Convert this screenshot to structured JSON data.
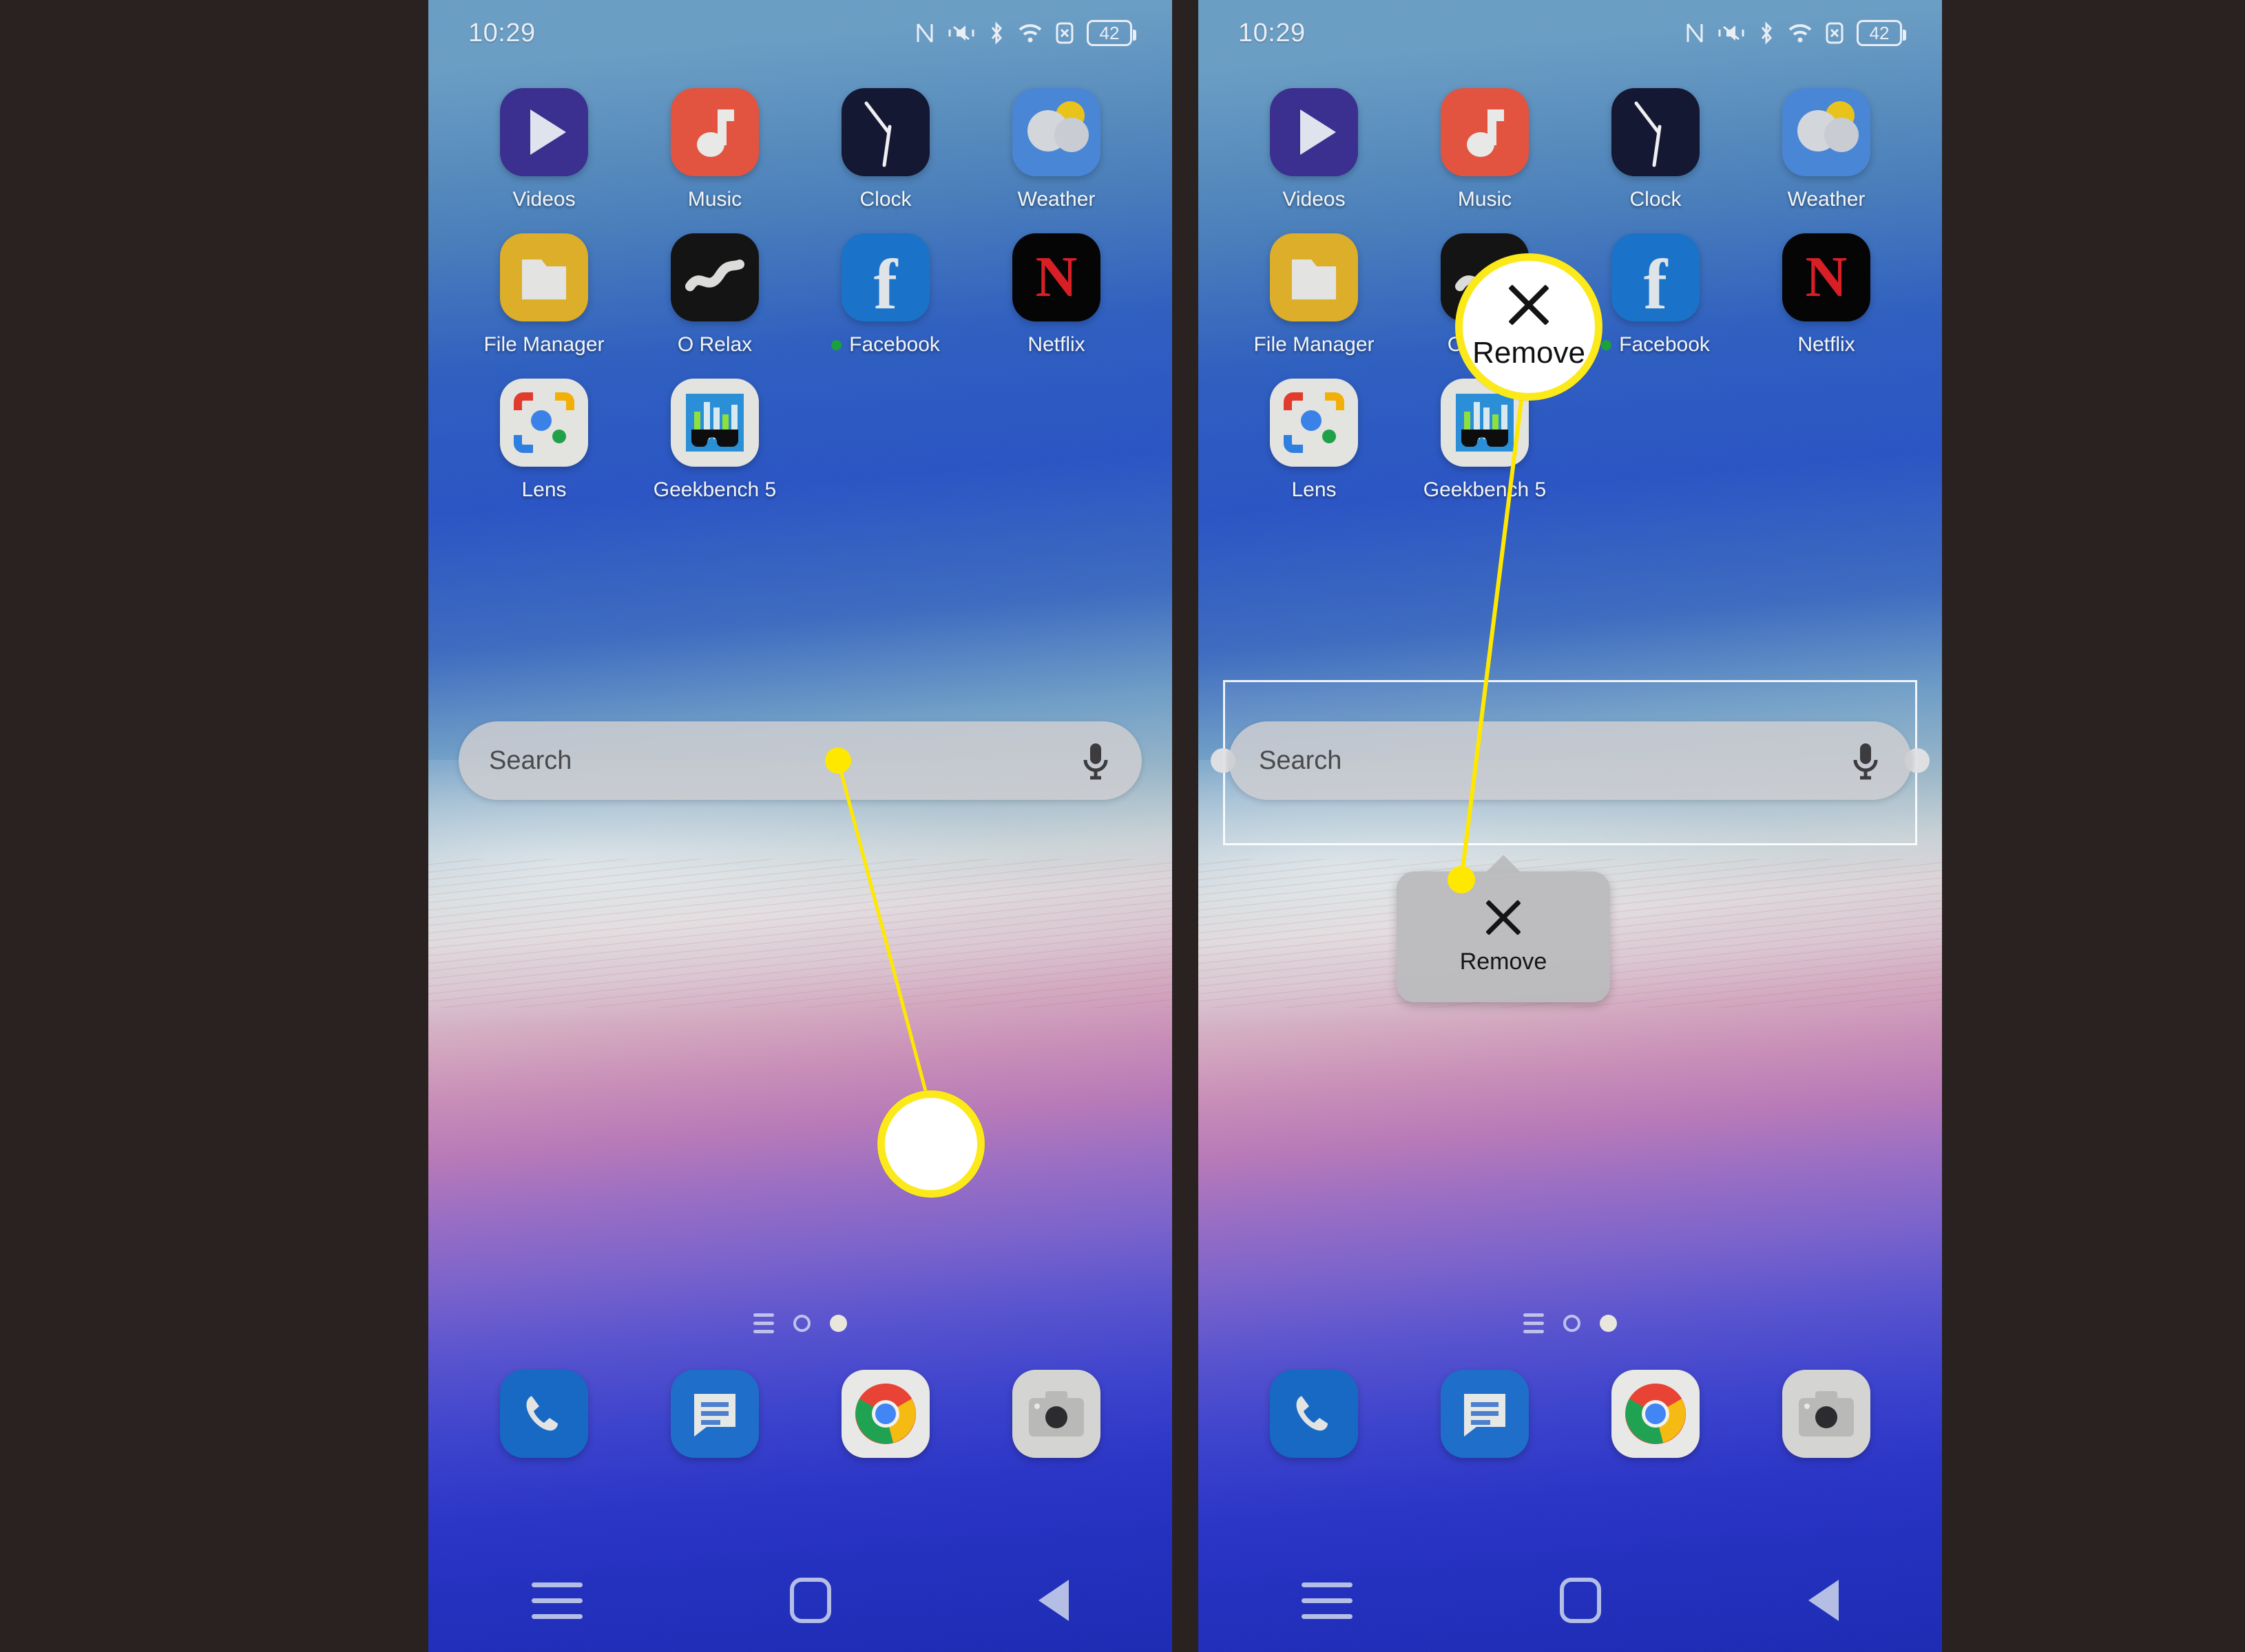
{
  "meta": {
    "background_color": "#2a2220",
    "annotation_color": "#ffe800",
    "panel_count": 2
  },
  "status_bar": {
    "time": "10:29",
    "battery_level": "42",
    "icons": [
      "nfc-icon",
      "vibrate-mute-icon",
      "bluetooth-icon",
      "wifi-icon",
      "sim-disabled-icon",
      "battery-icon"
    ]
  },
  "home_screen": {
    "rows": [
      [
        {
          "label": "Videos",
          "icon": "videos-icon",
          "badge": false
        },
        {
          "label": "Music",
          "icon": "music-icon",
          "badge": false
        },
        {
          "label": "Clock",
          "icon": "clock-icon",
          "badge": false
        },
        {
          "label": "Weather",
          "icon": "weather-icon",
          "badge": false
        }
      ],
      [
        {
          "label": "File Manager",
          "icon": "file-manager-icon",
          "badge": false
        },
        {
          "label": "O Relax",
          "icon": "o-relax-icon",
          "badge": false
        },
        {
          "label": "Facebook",
          "icon": "facebook-icon",
          "badge": true
        },
        {
          "label": "Netflix",
          "icon": "netflix-icon",
          "badge": false
        }
      ],
      [
        {
          "label": "Lens",
          "icon": "google-lens-icon",
          "badge": false
        },
        {
          "label": "Geekbench 5",
          "icon": "geekbench-icon",
          "badge": false
        }
      ]
    ],
    "search_widget": {
      "placeholder": "Search",
      "mic_icon": "microphone-icon"
    },
    "page_indicators": [
      "app-drawer-lines",
      "page-dot-hollow",
      "page-dot-filled"
    ],
    "dock": [
      {
        "label": "Phone",
        "icon": "phone-icon"
      },
      {
        "label": "Messages",
        "icon": "messages-icon"
      },
      {
        "label": "Chrome",
        "icon": "chrome-icon"
      },
      {
        "label": "Camera",
        "icon": "camera-icon"
      }
    ],
    "nav_bar": [
      "recents-icon",
      "home-icon",
      "back-icon"
    ]
  },
  "left_panel": {
    "annotation": {
      "type": "tap-target-callout",
      "magnifier_content": "",
      "start_label": "search-widget-anchor",
      "end_label": "empty-wallpaper-target"
    }
  },
  "right_panel": {
    "remove_popup": {
      "label": "Remove",
      "icon": "x-close-icon"
    },
    "magnifier": {
      "label": "Remove",
      "icon": "x-close-icon"
    },
    "selection": {
      "widget": "search-widget",
      "state": "selected-for-edit"
    }
  }
}
